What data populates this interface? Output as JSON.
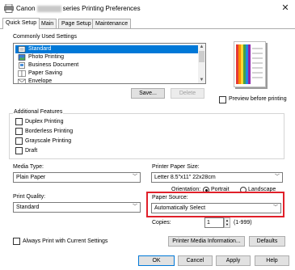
{
  "window": {
    "title_prefix": "Canon",
    "title_suffix": "series Printing Preferences",
    "close_glyph": "✕"
  },
  "tabs": [
    {
      "label": "Quick Setup",
      "active": true
    },
    {
      "label": "Main",
      "active": false
    },
    {
      "label": "Page Setup",
      "active": false
    },
    {
      "label": "Maintenance",
      "active": false
    }
  ],
  "commonly_used": {
    "label": "Commonly Used Settings",
    "items": [
      {
        "label": "Standard",
        "selected": true,
        "icon": "standard-icon"
      },
      {
        "label": "Photo Printing",
        "selected": false,
        "icon": "photo-icon"
      },
      {
        "label": "Business Document",
        "selected": false,
        "icon": "document-icon"
      },
      {
        "label": "Paper Saving",
        "selected": false,
        "icon": "paper-saving-icon"
      },
      {
        "label": "Envelope",
        "selected": false,
        "icon": "envelope-icon"
      }
    ],
    "save_label": "Save...",
    "delete_label": "Delete"
  },
  "preview": {
    "checkbox_label": "Preview before printing",
    "checked": false
  },
  "additional_features": {
    "label": "Additional Features",
    "items": [
      {
        "label": "Duplex Printing",
        "checked": false
      },
      {
        "label": "Borderless Printing",
        "checked": false
      },
      {
        "label": "Grayscale Printing",
        "checked": false
      },
      {
        "label": "Draft",
        "checked": false
      }
    ]
  },
  "media_type": {
    "label": "Media Type:",
    "value": "Plain Paper"
  },
  "printer_paper_size": {
    "label": "Printer Paper Size:",
    "value": "Letter 8.5\"x11\" 22x28cm"
  },
  "orientation": {
    "label": "Orientation:",
    "portrait_label": "Portrait",
    "landscape_label": "Landscape",
    "selected": "Portrait"
  },
  "print_quality": {
    "label": "Print Quality:",
    "value": "Standard"
  },
  "paper_source": {
    "label": "Paper Source:",
    "value": "Automatically Select"
  },
  "copies": {
    "label": "Copies:",
    "value": "1",
    "range": "(1-999)"
  },
  "always_print": {
    "label": "Always Print with Current Settings",
    "checked": false
  },
  "printer_media_info_label": "Printer Media Information...",
  "defaults_label": "Defaults",
  "dialog_buttons": {
    "ok": "OK",
    "cancel": "Cancel",
    "apply": "Apply",
    "help": "Help"
  },
  "colors": {
    "selection": "#0078d7",
    "highlight_box": "#e0202a"
  }
}
